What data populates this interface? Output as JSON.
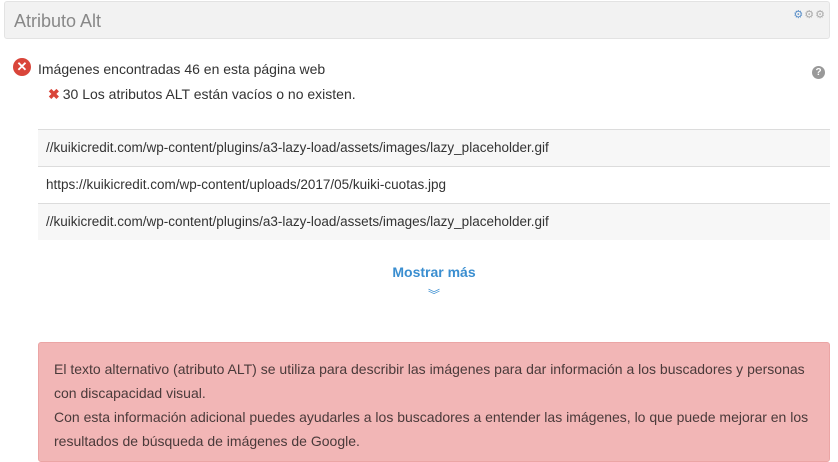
{
  "header": {
    "title": "Atributo Alt"
  },
  "summary": {
    "text": "Imágenes encontradas 46 en esta página web",
    "status_icon": "error-x-circle-icon"
  },
  "detail": {
    "text": "30 Los atributos ALT están vacíos o no existen."
  },
  "images": [
    "//kuikicredit.com/wp-content/plugins/a3-lazy-load/assets/images/lazy_placeholder.gif",
    "https://kuikicredit.com/wp-content/uploads/2017/05/kuiki-cuotas.jpg",
    "//kuikicredit.com/wp-content/plugins/a3-lazy-load/assets/images/lazy_placeholder.gif"
  ],
  "show_more": {
    "label": "Mostrar más"
  },
  "alert": {
    "line1": "El texto alternativo (atributo ALT) se utiliza para describir las imágenes para dar información a los buscadores y personas con discapacidad visual.",
    "line2": "Con esta información adicional puedes ayudarles a los buscadores a entender las imágenes, lo que puede mejorar en los resultados de búsqueda de imágenes de Google."
  },
  "colors": {
    "accent": "#3a8ed0",
    "error": "#d9453a",
    "alert_bg": "#f2b6b6"
  }
}
